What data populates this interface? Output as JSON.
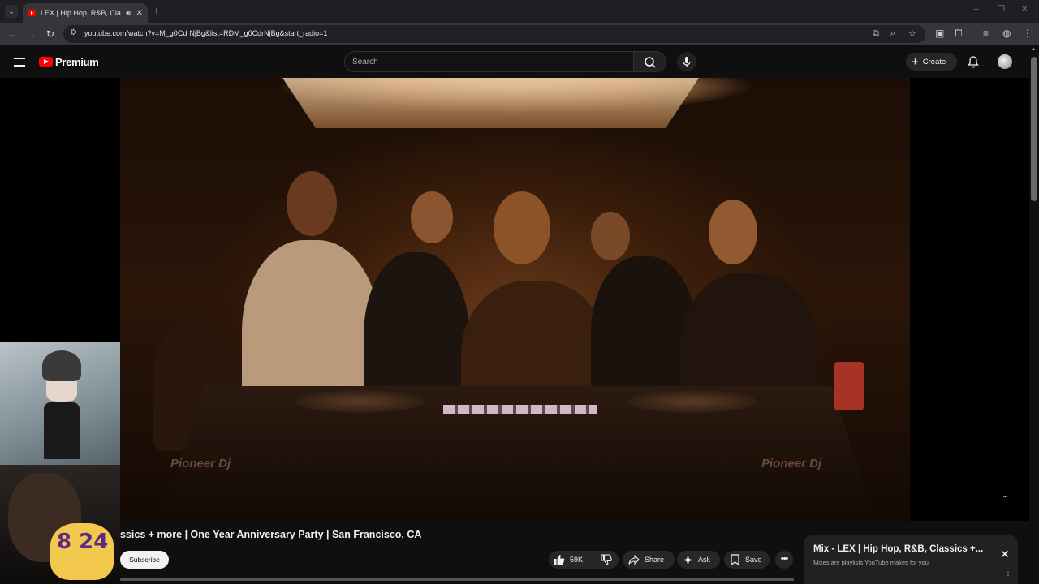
{
  "browser": {
    "tab_title": "LEX | Hip Hop, R&B, Classics +",
    "new_tab_label": "+",
    "url": "youtube.com/watch?v=M_g0CdrNjBg&list=RDM_g0CdrNjBg&start_radio=1",
    "window_controls": [
      "–",
      "❐",
      "✕"
    ]
  },
  "header": {
    "logo_text": "Premium",
    "search_placeholder": "Search",
    "create_label": "Create"
  },
  "video": {
    "brand_left": "Pioneer Dj",
    "brand_right": "Pioneer Dj",
    "jersey_number": "8 24",
    "title": "ssics + more | One Year Anniversary Party | San Francisco, CA"
  },
  "actions": {
    "subscribe_label": "Subscribe",
    "like_count": "59K",
    "share_label": "Share",
    "ask_label": "Ask",
    "save_label": "Save"
  },
  "mix": {
    "title": "Mix - LEX | Hip Hop, R&B, Classics +...",
    "subtitle": "Mixes are playlists YouTube makes for you"
  },
  "colors": {
    "brand_red": "#ff0000",
    "background": "#0f0f0f",
    "pill": "#272727"
  }
}
